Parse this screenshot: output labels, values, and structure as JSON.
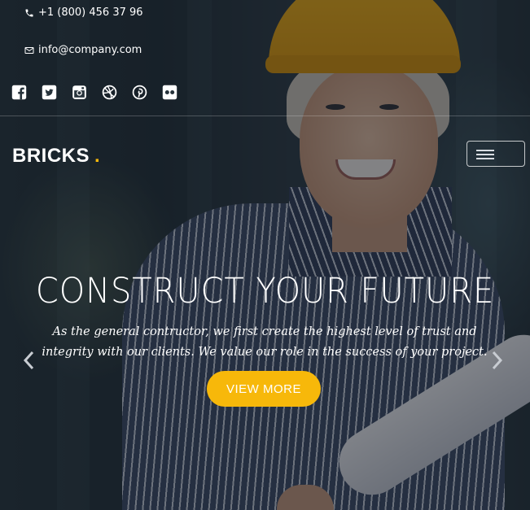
{
  "topbar": {
    "phone": "+1 (800) 456 37 96",
    "email": "info@company.com",
    "social": [
      "facebook-icon",
      "twitter-icon",
      "instagram-icon",
      "dribbble-icon",
      "pinterest-icon",
      "flickr-icon"
    ]
  },
  "nav": {
    "logo_text": "BRICKS",
    "logo_dot": "."
  },
  "hero": {
    "title": "CONSTRUCT YOUR FUTURE",
    "text": "As the general contructor, we first create the highest level of trust and integrity with our clients. We value our role in the success of your project.",
    "button_label": "VIEW MORE"
  },
  "colors": {
    "accent": "#f7b80a",
    "text": "#ffffff"
  }
}
